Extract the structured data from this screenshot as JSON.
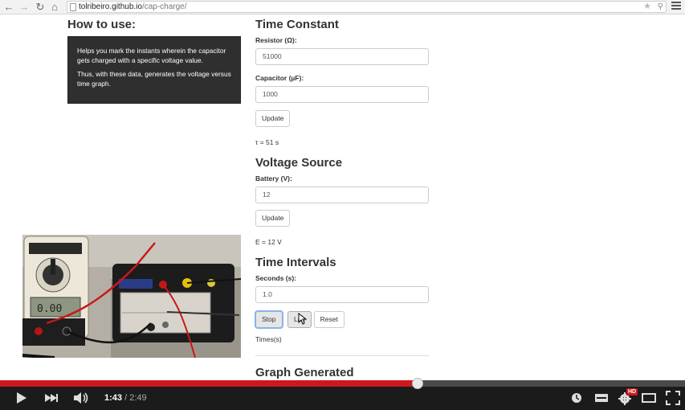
{
  "browser": {
    "url_host": "tolribeiro.github.io",
    "url_path": "/cap-charge/"
  },
  "help": {
    "title": "How to use:",
    "paragraph1": "Helps you mark the instants wherein the capacitor gets charged with a specific voltage value.",
    "paragraph2": "Thus, with these data, generates the voltage versus time graph."
  },
  "time_constant": {
    "title": "Time Constant",
    "resistor_label": "Resistor (Ω):",
    "resistor_value": "51000",
    "capacitor_label": "Capacitor (µF):",
    "capacitor_value": "1000",
    "update_label": "Update",
    "tau_readout": "τ = 51 s"
  },
  "voltage_source": {
    "title": "Voltage Source",
    "battery_label": "Battery (V):",
    "battery_value": "12",
    "update_label": "Update",
    "e_readout": "E = 12 V"
  },
  "time_intervals": {
    "title": "Time Intervals",
    "seconds_label": "Seconds (s):",
    "seconds_value": "1.0",
    "stop_label": "Stop",
    "lap_label": "Lap",
    "reset_label": "Reset",
    "times_label": "Times(s)"
  },
  "graph": {
    "title": "Graph Generated"
  },
  "player": {
    "current_time": "1:43",
    "duration": "/ 2:49",
    "progress": 0.61,
    "hd_badge": "HD",
    "colors": {
      "progress": "#cc181e",
      "hd": "#cc181e"
    }
  }
}
